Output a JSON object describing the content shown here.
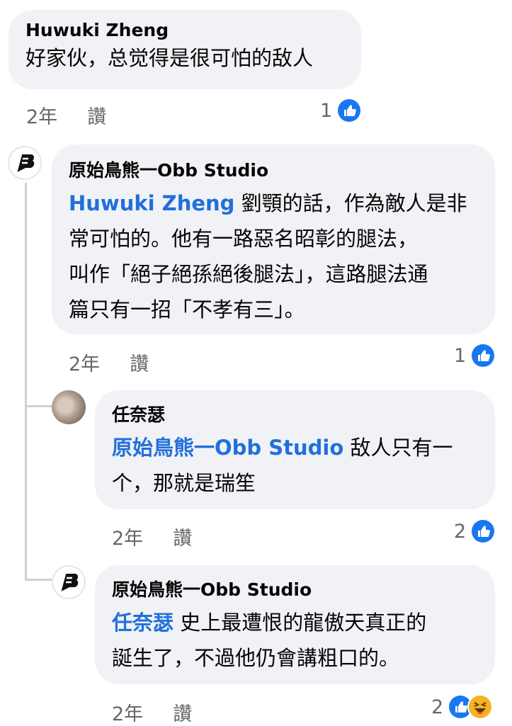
{
  "comments": [
    {
      "author": "Huwuki Zheng",
      "text": "好家伙，总觉得是很可怕的敌人",
      "time": "2年",
      "like_label": "讚",
      "reaction_count": "1",
      "reactions": [
        "like"
      ]
    },
    {
      "author": "原始鳥熊一Obb Studio",
      "mention": "Huwuki Zheng",
      "text_lines": [
        " 劉顎的話，作為敵人是非",
        "常可怕的。他有一路惡名昭彰的腿法，",
        "叫作「絕子絕孫絕後腿法」，這路腿法通",
        "篇只有一招「不孝有三」。"
      ],
      "time": "2年",
      "like_label": "讚",
      "reaction_count": "1",
      "reactions": [
        "like"
      ]
    },
    {
      "author": "任奈瑟",
      "mention": "原始鳥熊一Obb Studio",
      "text_lines": [
        " 敌人只有一",
        "个，那就是瑞笙"
      ],
      "time": "2年",
      "like_label": "讚",
      "reaction_count": "2",
      "reactions": [
        "like"
      ]
    },
    {
      "author": "原始鳥熊一Obb Studio",
      "mention": "任奈瑟",
      "text_lines": [
        " 史上最遭恨的龍傲天真正的",
        "誕生了，不過他仍會講粗口的。"
      ],
      "time": "2年",
      "like_label": "讚",
      "reaction_count": "2",
      "reactions": [
        "like",
        "haha"
      ]
    }
  ],
  "colors": {
    "like": "#1877f2",
    "haha": "#f7b125",
    "mention": "#216fdb",
    "bubble": "#f0f2f5"
  },
  "icons": {
    "logo_avatar": "obb-studio-logo",
    "photo_avatar": "user-photo"
  }
}
